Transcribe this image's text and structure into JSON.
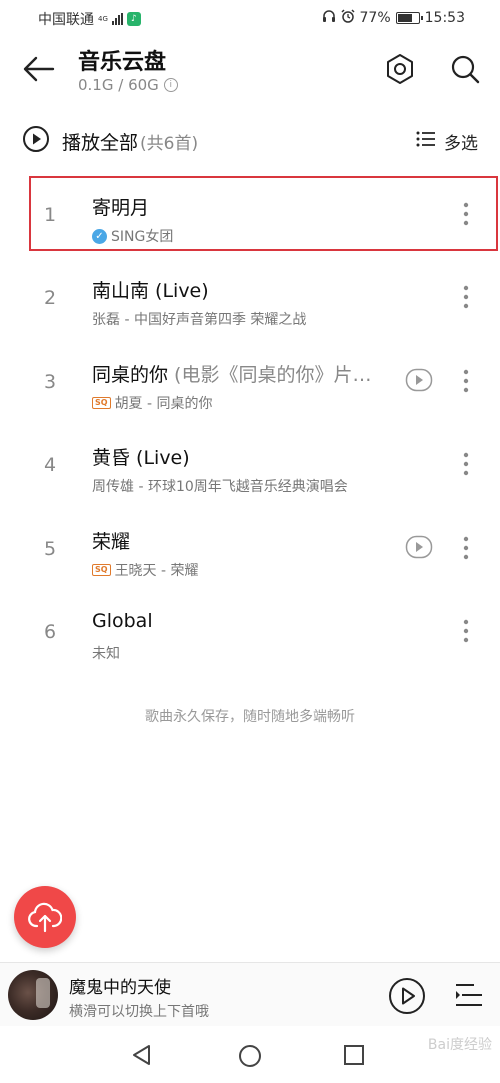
{
  "status_bar": {
    "carrier": "中国联通",
    "network": "4G",
    "battery": "77%",
    "battery_level": 0.77,
    "time": "15:53"
  },
  "header": {
    "title": "音乐云盘",
    "storage": "0.1G / 60G"
  },
  "play_all": {
    "label": "播放全部",
    "count": "(共6首)",
    "multi_select": "多选"
  },
  "songs": [
    {
      "num": "1",
      "title": "寄明月",
      "title_extra": "",
      "meta": "SING女团",
      "badge": "verified",
      "has_mv": false,
      "selected": true
    },
    {
      "num": "2",
      "title": "南山南 (Live)",
      "title_extra": "",
      "meta": "张磊 - 中国好声音第四季 荣耀之战",
      "badge": "",
      "has_mv": false
    },
    {
      "num": "3",
      "title": "同桌的你 ",
      "title_extra": "(电影《同桌的你》片…",
      "meta": "胡夏 - 同桌的你",
      "badge": "SQ",
      "has_mv": true
    },
    {
      "num": "4",
      "title": "黄昏 (Live)",
      "title_extra": "",
      "meta": "周传雄 - 环球10周年飞越音乐经典演唱会",
      "badge": "",
      "has_mv": false
    },
    {
      "num": "5",
      "title": "荣耀",
      "title_extra": "",
      "meta": "王晓天 - 荣耀",
      "badge": "SQ",
      "has_mv": true
    },
    {
      "num": "6",
      "title": "Global",
      "title_extra": "",
      "meta": "未知",
      "badge": "",
      "has_mv": false
    }
  ],
  "footer_tip": "歌曲永久保存，随时随地多端畅听",
  "mini_player": {
    "title": "魔鬼中的天使",
    "subtitle": "横滑可以切换上下首哦"
  },
  "watermark": "Bai度经验",
  "colors": {
    "accent": "#f04848",
    "highlight_border": "#d9363e",
    "verified": "#4aa7e6",
    "sq": "#e07a2c"
  }
}
